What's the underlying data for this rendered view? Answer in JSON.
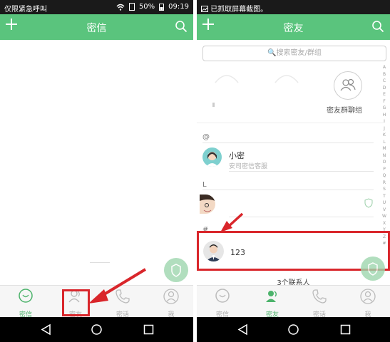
{
  "left": {
    "status": {
      "carrier": "仅限紧急呼叫",
      "battery": "50%",
      "time": "09:19"
    },
    "appbar": {
      "title": "密信"
    },
    "tabs": [
      {
        "label": "密信",
        "icon": "chat-bubble-icon"
      },
      {
        "label": "密友",
        "icon": "contacts-icon"
      },
      {
        "label": "密话",
        "icon": "phone-icon"
      },
      {
        "label": "我",
        "icon": "profile-icon"
      }
    ]
  },
  "right": {
    "status": {
      "notice": "已抓取屏幕截图。"
    },
    "appbar": {
      "title": "密友"
    },
    "search": {
      "placeholder": "🔍搜索密友/群组"
    },
    "group_chat_label": "密友群聊组",
    "sections": {
      "at": "@",
      "l": "L",
      "hash": "#"
    },
    "contacts": [
      {
        "name": "小密",
        "sub": "安司密信客服"
      },
      {
        "name": "",
        "sub": ""
      },
      {
        "name": "123",
        "sub": ""
      }
    ],
    "alpha_index": [
      "A",
      "B",
      "C",
      "D",
      "E",
      "F",
      "G",
      "H",
      "I",
      "J",
      "K",
      "L",
      "M",
      "N",
      "O",
      "P",
      "Q",
      "R",
      "S",
      "T",
      "U",
      "V",
      "W",
      "X",
      "Y",
      "Z",
      "#"
    ],
    "count": "3个联系人",
    "tabs": [
      {
        "label": "密信",
        "icon": "chat-bubble-icon"
      },
      {
        "label": "密友",
        "icon": "contacts-icon"
      },
      {
        "label": "密话",
        "icon": "phone-icon"
      },
      {
        "label": "我",
        "icon": "profile-icon"
      }
    ]
  },
  "colors": {
    "accent": "#5ac47d",
    "highlight": "#d9262b"
  }
}
